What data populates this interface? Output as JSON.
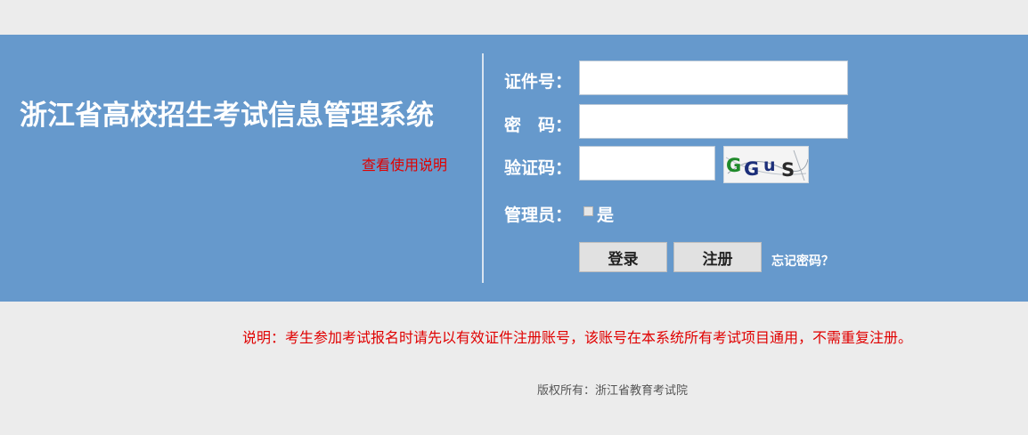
{
  "header": {
    "system_title": "浙江省高校招生考试信息管理系统",
    "help_link": "查看使用说明"
  },
  "login_form": {
    "id_label": "证件号：",
    "id_value": "",
    "password_label": "密　码：",
    "password_value": "",
    "captcha_label": "验证码：",
    "captcha_value": "",
    "captcha_image_text": "GGuS",
    "admin_label": "管理员：",
    "admin_option": "是",
    "admin_checked": false,
    "login_button": "登录",
    "register_button": "注册",
    "forgot_link": "忘记密码？"
  },
  "notice": {
    "text": "说明：考生参加考试报名时请先以有效证件注册账号，该账号在本系统所有考试项目通用，不需重复注册。"
  },
  "footer": {
    "copyright": "版权所有：浙江省教育考试院"
  },
  "colors": {
    "banner": "#6699cc",
    "background": "#ececec",
    "alert_red": "#e00000"
  }
}
